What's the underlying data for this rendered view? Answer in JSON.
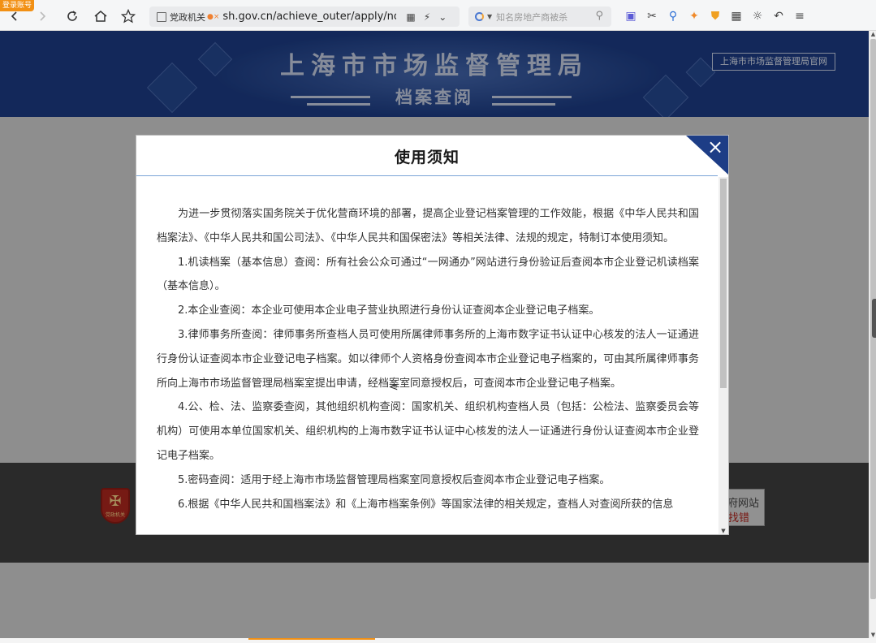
{
  "browser": {
    "login_badge": "登录账号",
    "address_bar": {
      "site_label": "党政机关",
      "url": "sh.gov.cn/achieve_outer/apply/notice"
    },
    "search": {
      "placeholder": "知名房地产商被杀"
    }
  },
  "header": {
    "title": "上海市市场监督管理局",
    "subtitle": "档案查阅",
    "official_site_link": "上海市市场监督管理局官网"
  },
  "footer": {
    "emblem_text": "党政机关",
    "badge_line1": "府网站",
    "badge_line2": "找错"
  },
  "modal": {
    "title": "使用须知",
    "close_symbol": "×",
    "paragraphs": [
      "为进一步贯彻落实国务院关于优化营商环境的部署，提高企业登记档案管理的工作效能，根据《中华人民共和国档案法》、《中华人民共和国公司法》、《中华人民共和国保密法》等相关法律、法规的规定，特制订本使用须知。",
      "1.机读档案（基本信息）查阅：所有社会公众可通过“一网通办”网站进行身份验证后查阅本市企业登记机读档案（基本信息）。",
      "2.本企业查阅：本企业可使用本企业电子营业执照进行身份认证查阅本企业登记电子档案。",
      "3.律师事务所查阅：律师事务所查档人员可使用所属律师事务所的上海市数字证书认证中心核发的法人一证通进行身份认证查阅本市企业登记电子档案。如以律师个人资格身份查阅本市企业登记电子档案的，可由其所属律师事务所向上海市市场监督管理局档案室提出申请，经档案室同意授权后，可查阅本市企业登记电子档案。",
      "4.公、检、法、监察委查阅，其他组织机构查阅：国家机关、组织机构查档人员（包括：公检法、监察委员会等机构）可使用本单位国家机关、组织机构的上海市数字证书认证中心核发的法人一证通进行身份认证查阅本市企业登记电子档案。",
      "5.密码查阅：适用于经上海市市场监督管理局档案室同意授权后查阅本市企业登记电子档案。",
      "6.根据《中华人民共和国档案法》和《上海市档案条例》等国家法律的相关规定，查档人对查阅所获的信息"
    ]
  },
  "icons": {
    "back": "back-icon",
    "forward": "forward-icon",
    "refresh": "refresh-icon",
    "home": "home-icon",
    "favorite": "star-icon",
    "close": "close-icon"
  },
  "colors": {
    "banner_blue": "#1d3d86",
    "rule_blue": "#7aa4d6",
    "badge_orange": "#f29014"
  }
}
